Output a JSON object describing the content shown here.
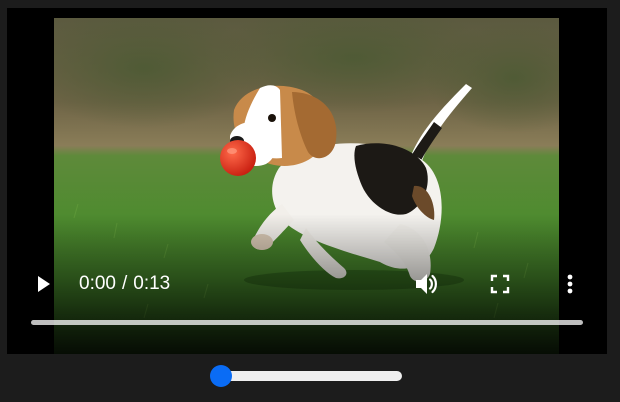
{
  "player": {
    "time": {
      "current": "0:00",
      "separator": "/",
      "duration": "0:13"
    },
    "progress_fraction": 0.0,
    "icons": {
      "play": "play-icon",
      "volume": "volume-icon",
      "fullscreen": "fullscreen-icon",
      "more": "more-vertical-icon"
    }
  },
  "slider": {
    "value_fraction": 0.0,
    "accent_color": "#0a6cf5",
    "track_color": "#efefef"
  }
}
